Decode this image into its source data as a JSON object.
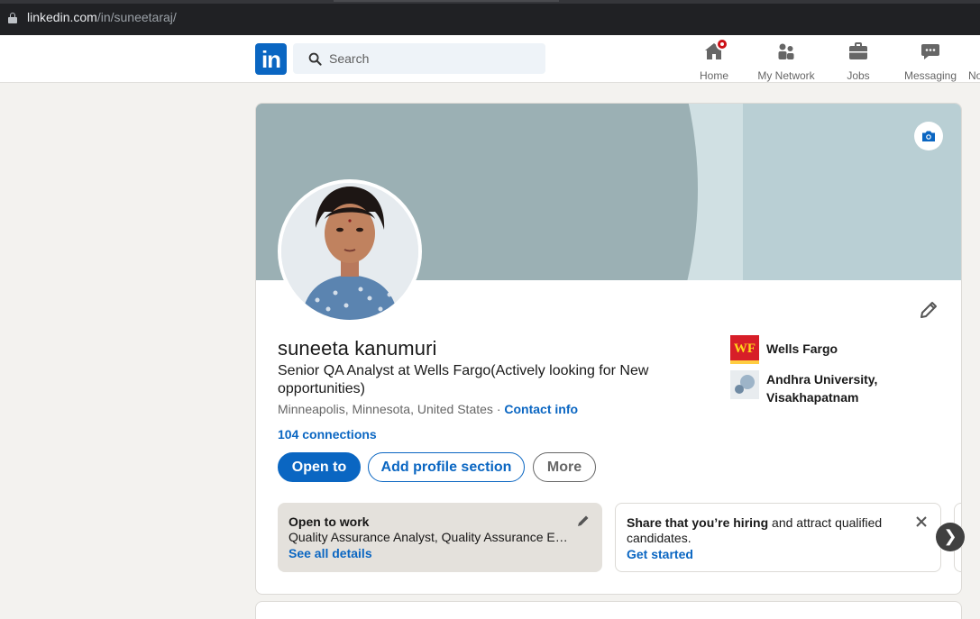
{
  "browser": {
    "url_host": "linkedin.com",
    "url_path": "/in/suneetaraj/"
  },
  "nav": {
    "logo_text": "in",
    "search_placeholder": "Search",
    "items": [
      {
        "label": "Home",
        "icon": "home-icon",
        "has_notification": true
      },
      {
        "label": "My Network",
        "icon": "my-network-icon"
      },
      {
        "label": "Jobs",
        "icon": "jobs-icon"
      },
      {
        "label": "Messaging",
        "icon": "messaging-icon"
      },
      {
        "label": "No",
        "icon": "notifications-icon"
      }
    ]
  },
  "profile": {
    "name": "suneeta kanumuri",
    "headline": "Senior QA Analyst at Wells Fargo(Actively looking for New opportunities)",
    "location": "Minneapolis, Minnesota, United States",
    "separator": "·",
    "contact_info_label": "Contact info",
    "connections": "104 connections",
    "buttons": {
      "open_to": "Open to",
      "add_section": "Add profile section",
      "more": "More"
    },
    "experience": [
      {
        "name": "Wells Fargo",
        "logo_text": "WF"
      },
      {
        "name": "Andhra University, Visakhapatnam"
      }
    ]
  },
  "open_to_work": {
    "title": "Open to work",
    "description": "Quality Assurance Analyst, Quality Assurance Engineer",
    "link": "See all details"
  },
  "hiring": {
    "text_bold": "Share that you’re hiring",
    "text_rest": " and attract qualified candidates.",
    "link": "Get started"
  },
  "carousel": {
    "next_glyph": "❯"
  },
  "colors": {
    "linkedin_blue": "#0a66c2",
    "notification_red": "#cc1016",
    "page_bg": "#f3f2ef"
  }
}
